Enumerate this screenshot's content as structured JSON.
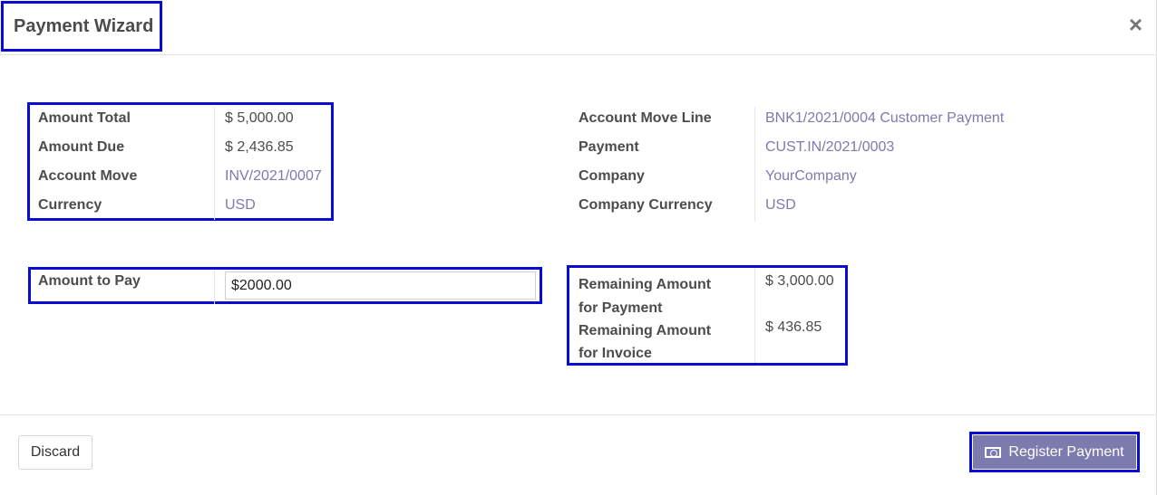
{
  "dialog": {
    "title": "Payment Wizard",
    "close_glyph": "×"
  },
  "left_group": {
    "fields": [
      {
        "label": "Amount Total",
        "value": "$ 5,000.00"
      },
      {
        "label": "Amount Due",
        "value": "$ 2,436.85"
      },
      {
        "label": "Account Move",
        "value": "INV/2021/0007"
      },
      {
        "label": "Currency",
        "value": "USD"
      }
    ]
  },
  "right_group": {
    "fields": [
      {
        "label": "Account Move Line",
        "value": "BNK1/2021/0004 Customer Payment"
      },
      {
        "label": "Payment",
        "value": "CUST.IN/2021/0003"
      },
      {
        "label": "Company",
        "value": "YourCompany"
      },
      {
        "label": "Company Currency",
        "value": "USD"
      }
    ]
  },
  "amount_to_pay": {
    "label": "Amount to Pay",
    "value": "$2000.00"
  },
  "remaining": {
    "payment_label_1": "Remaining Amount",
    "payment_label_2": "for Payment",
    "payment_value": "$ 3,000.00",
    "invoice_label_1": "Remaining Amount",
    "invoice_label_2": "for Invoice",
    "invoice_value": "$ 436.85"
  },
  "footer": {
    "discard_label": "Discard",
    "register_label": "Register Payment",
    "register_icon": "money-icon"
  },
  "colors": {
    "link": "#7c7bad",
    "primary_button": "#7c7bad",
    "highlight_border": "#0a0ad6"
  }
}
